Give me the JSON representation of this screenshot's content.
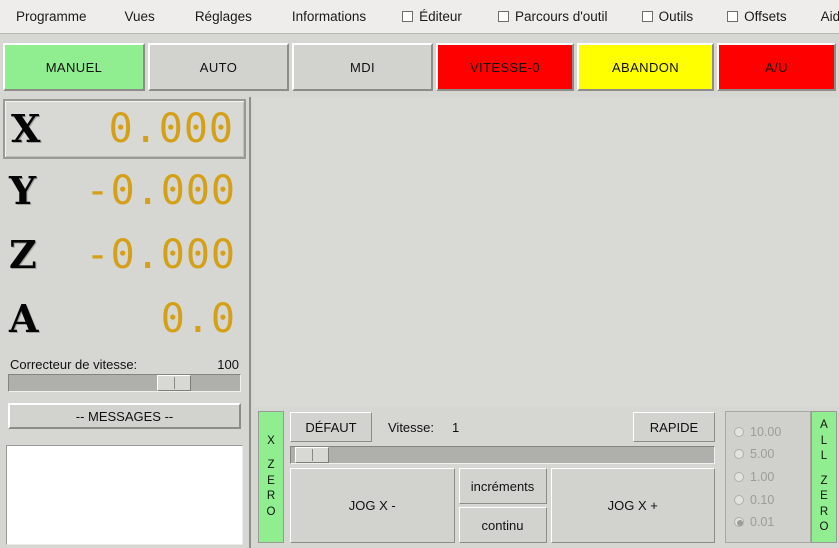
{
  "menubar": {
    "items": [
      {
        "label": "Programme",
        "type": "menu"
      },
      {
        "label": "Vues",
        "type": "menu"
      },
      {
        "label": "Réglages",
        "type": "menu"
      },
      {
        "label": "Informations",
        "type": "menu"
      },
      {
        "label": "Éditeur",
        "type": "checkbox",
        "checked": false
      },
      {
        "label": "Parcours d'outil",
        "type": "checkbox",
        "checked": false
      },
      {
        "label": "Outils",
        "type": "checkbox",
        "checked": false
      },
      {
        "label": "Offsets",
        "type": "checkbox",
        "checked": false
      },
      {
        "label": "Aide",
        "type": "menu"
      }
    ]
  },
  "mode_tabs": [
    {
      "label": "MANUEL",
      "color": "#90ee90",
      "active": true
    },
    {
      "label": "AUTO",
      "color": "#d2d2ce",
      "active": false
    },
    {
      "label": "MDI",
      "color": "#d2d2ce",
      "active": false
    },
    {
      "label": "VITESSE-0",
      "color": "#ff0000",
      "active": false
    },
    {
      "label": "ABANDON",
      "color": "#ffff00",
      "active": false
    },
    {
      "label": "A/U",
      "color": "#ff0000",
      "active": false
    }
  ],
  "dro": {
    "value_color": "#d4a017",
    "axes": [
      {
        "axis": "X",
        "value": "0.000",
        "selected": true
      },
      {
        "axis": "Y",
        "value": "-0.000",
        "selected": false
      },
      {
        "axis": "Z",
        "value": "-0.000",
        "selected": false
      },
      {
        "axis": "A",
        "value": "0.0",
        "selected": false
      }
    ]
  },
  "feed_override": {
    "label": "Correcteur de vitesse:",
    "value": "100",
    "percent": 75
  },
  "messages": {
    "button_label": "-- MESSAGES --",
    "text": ""
  },
  "jog": {
    "zero_left": {
      "lines": [
        "X",
        "Z",
        "E",
        "R",
        "O"
      ]
    },
    "zero_right": {
      "lines": [
        "A",
        "L",
        "L",
        "Z",
        "E",
        "R",
        "O"
      ]
    },
    "default_button": "DÉFAUT",
    "rapid_button": "RAPIDE",
    "speed_label": "Vitesse:",
    "speed_value": "1",
    "speed_percent": 1,
    "jog_minus": "JOG X -",
    "jog_plus": "JOG X +",
    "mode_increments": "incréments",
    "mode_continuous": "continu",
    "increments": [
      {
        "label": "10.00",
        "selected": false
      },
      {
        "label": "5.00",
        "selected": false
      },
      {
        "label": "1.00",
        "selected": false
      },
      {
        "label": "0.10",
        "selected": false
      },
      {
        "label": "0.01",
        "selected": true
      }
    ]
  }
}
